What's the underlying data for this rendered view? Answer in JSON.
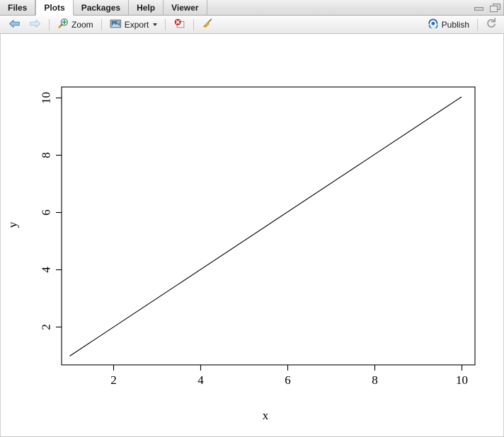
{
  "window": {
    "controls": [
      {
        "name": "minimize",
        "label": "Minimize"
      },
      {
        "name": "maximize",
        "label": "Maximize"
      }
    ]
  },
  "tabs": [
    {
      "id": "files",
      "label": "Files",
      "active": false
    },
    {
      "id": "plots",
      "label": "Plots",
      "active": true
    },
    {
      "id": "packages",
      "label": "Packages",
      "active": false
    },
    {
      "id": "help",
      "label": "Help",
      "active": false
    },
    {
      "id": "viewer",
      "label": "Viewer",
      "active": false
    }
  ],
  "toolbar": {
    "back_icon": "arrow-left-icon",
    "forward_icon": "arrow-right-icon",
    "zoom_label": "Zoom",
    "zoom_icon": "magnifier-plus-icon",
    "export_label": "Export",
    "export_icon": "export-image-icon",
    "export_has_dropdown": true,
    "remove_plot_icon": "remove-plot-icon",
    "clear_plots_icon": "broom-icon",
    "publish_label": "Publish",
    "publish_icon": "publish-icon",
    "refresh_icon": "refresh-icon"
  },
  "colors": {
    "accent_blue": "#3a76b8",
    "publish_blue": "#2e6fa8",
    "remove_red": "#cc2127",
    "zoom_green": "#3f9b35",
    "plot_line": "#000000",
    "toolbar_bg": "#f1f1f1",
    "tabbar_bg": "#e4e4e4",
    "active_tab_bg": "#ffffff"
  },
  "chart_data": {
    "type": "line",
    "title": "",
    "xlabel": "x",
    "ylabel": "y",
    "x": [
      1,
      2,
      3,
      4,
      5,
      6,
      7,
      8,
      9,
      10
    ],
    "y": [
      1,
      2,
      3,
      4,
      5,
      6,
      7,
      8,
      9,
      10
    ],
    "series": [
      {
        "name": "line",
        "values": [
          1,
          2,
          3,
          4,
          5,
          6,
          7,
          8,
          9,
          10
        ]
      }
    ],
    "xlim": [
      1,
      10
    ],
    "ylim": [
      1,
      10
    ],
    "xticks": [
      2,
      4,
      6,
      8,
      10
    ],
    "yticks": [
      2,
      4,
      6,
      8,
      10
    ],
    "grid": false,
    "legend": false,
    "box": true,
    "line_color": "#000000",
    "line_width": 1
  }
}
